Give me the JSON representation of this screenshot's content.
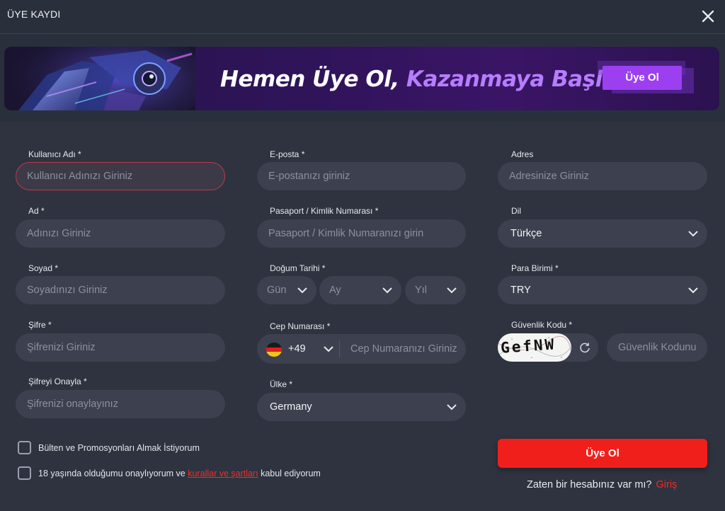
{
  "modal": {
    "title": "ÜYE KAYDI",
    "close_icon": "close-icon"
  },
  "banner": {
    "headline_white": "Hemen Üye Ol,",
    "headline_purple": "Kazanmaya Başla!",
    "cta_label": "Üye Ol",
    "accent": "#9c3ff0"
  },
  "form": {
    "username": {
      "label": "Kullanıcı Adı *",
      "placeholder": "Kullanıcı Adınızı Giriniz"
    },
    "first_name": {
      "label": "Ad *",
      "placeholder": "Adınızı Giriniz"
    },
    "last_name": {
      "label": "Soyad *",
      "placeholder": "Soyadınızı Giriniz"
    },
    "password": {
      "label": "Şifre *",
      "placeholder": "Şifrenizi Giriniz"
    },
    "password_confirm": {
      "label": "Şifreyi Onayla *",
      "placeholder": "Şifrenizi onaylayınız"
    },
    "email": {
      "label": "E-posta *",
      "placeholder": "E-postanızı giriniz"
    },
    "passport": {
      "label": "Pasaport / Kimlik Numarası *",
      "placeholder": "Pasaport / Kimlik Numaranızı girin"
    },
    "birth_date": {
      "label": "Doğum Tarihi *",
      "day": "Gün",
      "month": "Ay",
      "year": "Yıl"
    },
    "phone": {
      "label": "Cep Numarası *",
      "country_code": "+49",
      "flag_icon": "germany-flag-icon",
      "placeholder": "Cep Numaranızı Giriniz"
    },
    "country": {
      "label": "Ülke *",
      "value": "Germany"
    },
    "address": {
      "label": "Adres",
      "placeholder": "Adresinize Giriniz"
    },
    "language": {
      "label": "Dil",
      "value": "Türkçe"
    },
    "currency": {
      "label": "Para Birimi *",
      "value": "TRY"
    },
    "captcha": {
      "label": "Güvenlik Kodu *",
      "image_text": "GefNW",
      "placeholder": "Güvenlik Kodunu"
    }
  },
  "checkboxes": {
    "newsletter": "Bülten ve Promosyonları Almak İstiyorum",
    "terms_prefix": "18 yaşında olduğumu onaylıyorum ve ",
    "terms_link": "kurallar ve şartları",
    "terms_suffix": " kabul ediyorum"
  },
  "actions": {
    "submit_label": "Üye Ol",
    "have_account": "Zaten bir hesabınız var mı?",
    "login_link": "Giriş",
    "submit_color": "#f11f1b"
  }
}
